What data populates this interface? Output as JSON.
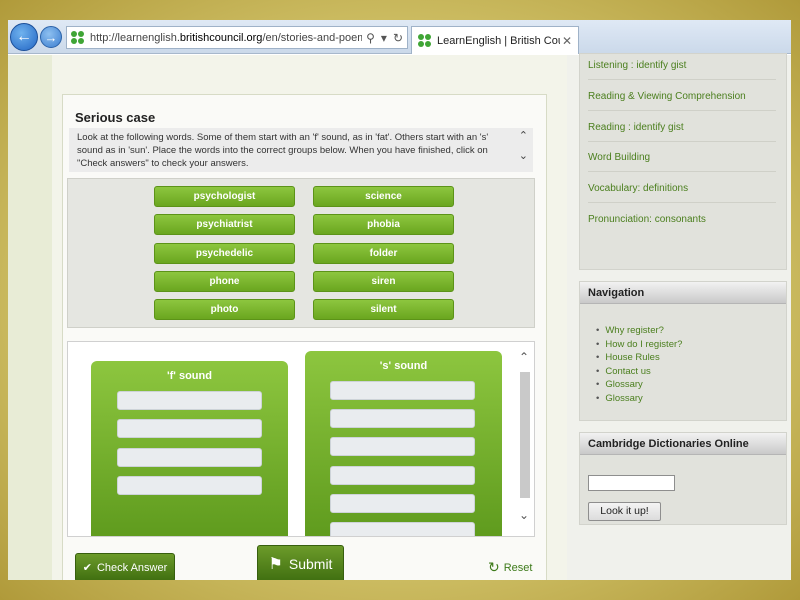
{
  "browser": {
    "url_prefix": "http://learnenglish.",
    "url_domain": "britishcouncil.org",
    "url_suffix": "/en/stories-and-poems/s",
    "tab_title": "LearnEnglish | British Coun...",
    "back_glyph": "←",
    "forward_glyph": "→",
    "search_glyph": "⚲",
    "dropdown_glyph": "▾",
    "refresh_glyph": "↻",
    "tab_close_glyph": "✕"
  },
  "activity": {
    "title": "Serious case",
    "instructions": "Look at the following words. Some of them start with an 'f' sound, as in 'fat'. Others start with an 's' sound as in 'sun'. Place the words into the correct groups below. When you have finished, click on \"Check answers\" to check your answers.",
    "scroll_up_glyph": "⌃",
    "scroll_down_glyph": "⌄",
    "words_left": [
      "psychologist",
      "psychiatrist",
      "psychedelic",
      "phone",
      "photo"
    ],
    "words_right": [
      "science",
      "phobia",
      "folder",
      "siren",
      "silent"
    ],
    "f_sound_title": "'f' sound",
    "s_sound_title": "'s' sound",
    "check_answer_label": "Check Answer",
    "submit_label": "Submit",
    "reset_label": "Reset",
    "check_icon": "✔",
    "flag_icon": "⚑",
    "reset_icon": "↻"
  },
  "sidebar": {
    "skills": [
      "Listening : identify gist",
      "Reading & Viewing Comprehension",
      "Reading : identify gist",
      "Word Building",
      "Vocabulary: definitions",
      "Pronunciation: consonants"
    ],
    "navigation_title": "Navigation",
    "navigation_items": [
      "Why register?",
      "How do I register?",
      "House Rules",
      "Contact us",
      "Glossary",
      "Glossary"
    ],
    "dictionary_title": "Cambridge Dictionaries Online",
    "dictionary_input_value": "",
    "dictionary_button": "Look it up!"
  },
  "colors": {
    "accent_green": "#7ab52e",
    "dark_green": "#3f6e10",
    "link_green": "#4b7f1e",
    "frame_gold": "#d4c66d"
  }
}
